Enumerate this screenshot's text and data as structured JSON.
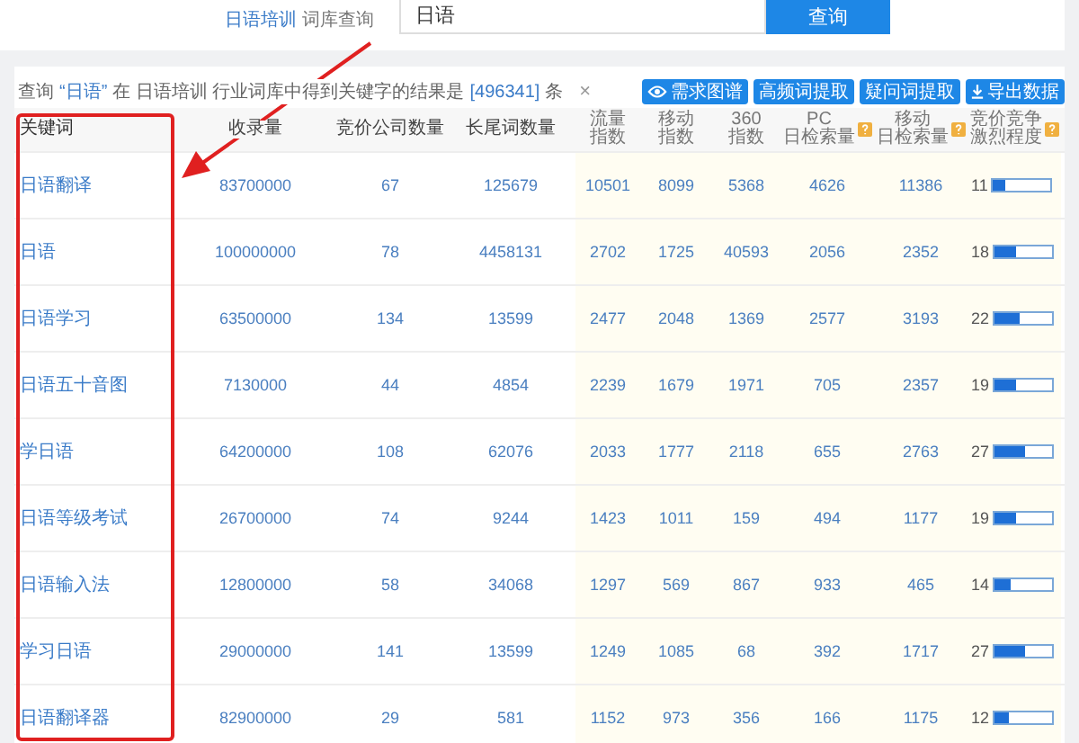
{
  "search_bar": {
    "industry": "日语培训",
    "label": "词库查询",
    "query": "日语",
    "button": "查询"
  },
  "result_info": {
    "prefix": "查询",
    "query": "“日语”",
    "middle": "在 日语培训 行业词库中得到关键字的结果是",
    "count": "[496341]",
    "suffix": "条",
    "close": "×"
  },
  "toolbar": [
    {
      "kind": "eye",
      "label": "需求图谱"
    },
    {
      "kind": "plain",
      "label": "高频词提取"
    },
    {
      "kind": "plain",
      "label": "疑问词提取"
    },
    {
      "kind": "download",
      "label": "导出数据"
    }
  ],
  "table": {
    "columns": [
      {
        "lines": [
          "关键词"
        ],
        "help": false
      },
      {
        "lines": [
          "收录量"
        ],
        "help": false
      },
      {
        "lines": [
          "竞价公司数量"
        ],
        "help": false
      },
      {
        "lines": [
          "长尾词数量"
        ],
        "help": false
      },
      {
        "lines": [
          "流量",
          "指数"
        ],
        "help": false
      },
      {
        "lines": [
          "移动",
          "指数"
        ],
        "help": false
      },
      {
        "lines": [
          "360",
          "指数"
        ],
        "help": false
      },
      {
        "lines": [
          "PC",
          "日检索量"
        ],
        "help": true
      },
      {
        "lines": [
          "移动",
          "日检索量"
        ],
        "help": true
      },
      {
        "lines": [
          "竞价竞争",
          "激烈程度"
        ],
        "help": true
      }
    ],
    "rows": [
      {
        "cells": [
          "日语翻译",
          "83700000",
          "67",
          "125679",
          "10501",
          "8099",
          "5368",
          "4626",
          "11386"
        ],
        "competition": "11",
        "level": 0.22
      },
      {
        "cells": [
          "日语",
          "100000000",
          "78",
          "4458131",
          "2702",
          "1725",
          "40593",
          "2056",
          "2352"
        ],
        "competition": "18",
        "level": 0.36
      },
      {
        "cells": [
          "日语学习",
          "63500000",
          "134",
          "13599",
          "2477",
          "2048",
          "1369",
          "2577",
          "3193"
        ],
        "competition": "22",
        "level": 0.44
      },
      {
        "cells": [
          "日语五十音图",
          "7130000",
          "44",
          "4854",
          "2239",
          "1679",
          "1971",
          "705",
          "2357"
        ],
        "competition": "19",
        "level": 0.38
      },
      {
        "cells": [
          "学日语",
          "64200000",
          "108",
          "62076",
          "2033",
          "1777",
          "2118",
          "655",
          "2763"
        ],
        "competition": "27",
        "level": 0.54
      },
      {
        "cells": [
          "日语等级考试",
          "26700000",
          "74",
          "9244",
          "1423",
          "1011",
          "159",
          "494",
          "1177"
        ],
        "competition": "19",
        "level": 0.38
      },
      {
        "cells": [
          "日语输入法",
          "12800000",
          "58",
          "34068",
          "1297",
          "569",
          "867",
          "933",
          "465"
        ],
        "competition": "14",
        "level": 0.28
      },
      {
        "cells": [
          "学习日语",
          "29000000",
          "141",
          "13599",
          "1249",
          "1085",
          "68",
          "392",
          "1717"
        ],
        "competition": "27",
        "level": 0.54
      },
      {
        "cells": [
          "日语翻译器",
          "82900000",
          "29",
          "581",
          "1152",
          "973",
          "356",
          "166",
          "1175"
        ],
        "competition": "12",
        "level": 0.24
      }
    ]
  }
}
